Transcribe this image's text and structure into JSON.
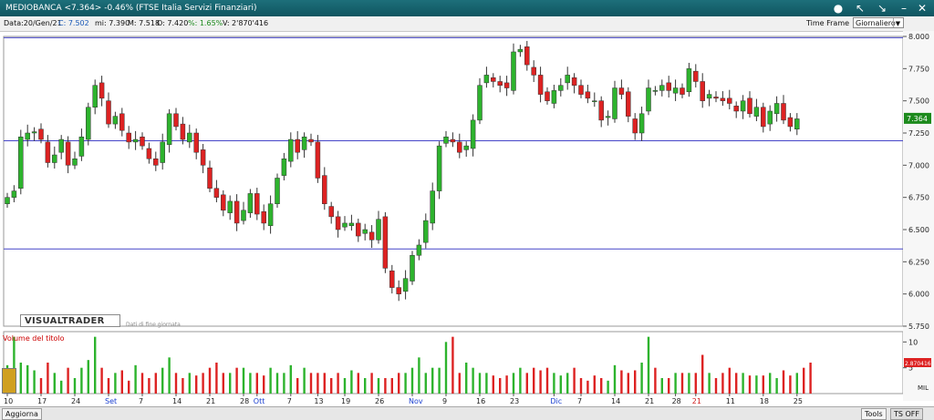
{
  "window": {
    "title": "MEDIOBANCA <7.364> -0.46%  (FTSE Italia Servizi Finanziari)",
    "colors": {
      "titlebar": "#16636d",
      "up": "#2db32d",
      "down": "#dd2222",
      "hline": "#4646c8",
      "last_price": "#1d8a1d"
    }
  },
  "infobar": {
    "date": "Data:20/Gen/21",
    "close": "C: 7.502",
    "min": "mi: 7.390",
    "max": "M: 7.518",
    "open": "O: 7.420",
    "pct": "%: 1.65%",
    "volume": "V: 2'870'416",
    "time_frame_label": "Time Frame",
    "time_frame_value": "Giornaliero"
  },
  "overlay": {
    "brand": "VISUALTRADER",
    "eod_note": "Dati di fine giornata",
    "volume_label": "Volume del titolo"
  },
  "bottom": {
    "left_button": "Aggiorna",
    "tools_button": "Tools",
    "ts_button": "TS OFF"
  },
  "chart_data": {
    "type": "candlestick",
    "price_axis": {
      "ticks": [
        "8.000",
        "7.750",
        "7.500",
        "7.250",
        "7.000",
        "6.750",
        "6.500",
        "6.250",
        "6.000",
        "5.750"
      ],
      "ylim": [
        5.75,
        8.0
      ]
    },
    "volume_axis": {
      "ticks": [
        "10",
        "5"
      ],
      "unit": "MIL",
      "ylim": [
        0,
        12
      ]
    },
    "last_price": "7.364",
    "last_volume_label": "2.870416",
    "horizontal_lines": [
      7.19,
      6.35,
      7.99
    ],
    "x_labels": [
      {
        "label": "10",
        "i": 0,
        "month": false
      },
      {
        "label": "17",
        "i": 5,
        "month": false
      },
      {
        "label": "24",
        "i": 10,
        "month": false
      },
      {
        "label": "Set",
        "i": 15,
        "month": true
      },
      {
        "label": "7",
        "i": 20,
        "month": false
      },
      {
        "label": "14",
        "i": 25,
        "month": false
      },
      {
        "label": "21",
        "i": 30,
        "month": false
      },
      {
        "label": "28",
        "i": 35,
        "month": false
      },
      {
        "label": "Ott",
        "i": 37,
        "month": true
      },
      {
        "label": "7",
        "i": 42,
        "month": false
      },
      {
        "label": "13",
        "i": 46,
        "month": false
      },
      {
        "label": "19",
        "i": 50,
        "month": false
      },
      {
        "label": "26",
        "i": 55,
        "month": false
      },
      {
        "label": "Nov",
        "i": 60,
        "month": true
      },
      {
        "label": "9",
        "i": 65,
        "month": false
      },
      {
        "label": "16",
        "i": 70,
        "month": false
      },
      {
        "label": "23",
        "i": 75,
        "month": false
      },
      {
        "label": "Dic",
        "i": 81,
        "month": true
      },
      {
        "label": "7",
        "i": 85,
        "month": false
      },
      {
        "label": "14",
        "i": 90,
        "month": false
      },
      {
        "label": "21",
        "i": 95,
        "month": false
      },
      {
        "label": "28",
        "i": 99,
        "month": false
      },
      {
        "label": "21",
        "i": 102,
        "month": false,
        "red": true
      },
      {
        "label": "11",
        "i": 107,
        "month": false
      },
      {
        "label": "18",
        "i": 112,
        "month": false
      },
      {
        "label": "25",
        "i": 117,
        "month": false
      }
    ],
    "closes": [
      6.75,
      6.8,
      7.22,
      7.25,
      7.26,
      7.2,
      7.02,
      7.08,
      7.2,
      7.0,
      7.05,
      7.22,
      7.45,
      7.62,
      7.52,
      7.32,
      7.38,
      7.27,
      7.18,
      7.2,
      7.15,
      7.05,
      7.0,
      7.18,
      7.4,
      7.3,
      7.2,
      7.25,
      7.1,
      7.0,
      6.82,
      6.75,
      6.65,
      6.72,
      6.55,
      6.65,
      6.78,
      6.62,
      6.55,
      6.7,
      6.9,
      7.05,
      7.2,
      7.1,
      7.22,
      7.18,
      6.9,
      6.7,
      6.6,
      6.5,
      6.55,
      6.55,
      6.45,
      6.5,
      6.42,
      6.58,
      6.2,
      6.05,
      6.0,
      6.12,
      6.3,
      6.38,
      6.57,
      6.8,
      7.15,
      7.22,
      7.18,
      7.1,
      7.15,
      7.35,
      7.62,
      7.7,
      7.65,
      7.62,
      7.6,
      7.88,
      7.9,
      7.78,
      7.7,
      7.55,
      7.5,
      7.58,
      7.62,
      7.7,
      7.62,
      7.55,
      7.52,
      7.5,
      7.35,
      7.38,
      7.6,
      7.55,
      7.38,
      7.25,
      7.4,
      7.6,
      7.58,
      7.62,
      7.58,
      7.6,
      7.55,
      7.75,
      7.65,
      7.5,
      7.55,
      7.52,
      7.5,
      7.48,
      7.42,
      7.5,
      7.4,
      7.45,
      7.3,
      7.42,
      7.48,
      7.35,
      7.3,
      7.36
    ],
    "volumes": [
      5.5,
      11,
      6,
      5.5,
      4.5,
      3,
      6,
      4,
      2.5,
      5,
      3,
      5,
      6.5,
      11,
      5,
      3,
      4,
      4.5,
      2.5,
      5.5,
      4,
      3,
      4,
      5,
      7,
      4,
      3,
      4,
      3.5,
      4,
      5,
      6,
      4,
      4,
      5,
      5,
      4,
      4,
      3.5,
      5,
      4,
      4,
      5.5,
      3,
      5,
      4,
      4,
      4,
      3,
      4,
      3,
      4.5,
      4,
      3,
      4,
      3,
      3,
      3,
      4,
      4,
      5,
      7,
      4,
      5,
      5,
      10,
      11,
      4,
      6,
      5,
      4,
      4,
      3.5,
      3,
      3.5,
      4,
      5,
      4,
      5,
      4.5,
      5,
      4,
      3.5,
      4,
      5,
      3,
      2.5,
      3.5,
      3,
      2.5,
      5.5,
      4.5,
      4,
      4.5,
      6,
      11,
      5,
      3,
      3,
      4,
      4,
      4,
      4,
      7.5,
      4,
      3,
      4,
      5,
      4,
      4,
      3.5,
      3.5,
      3.5,
      4,
      3,
      4.5,
      3.5,
      4,
      5,
      6
    ]
  }
}
